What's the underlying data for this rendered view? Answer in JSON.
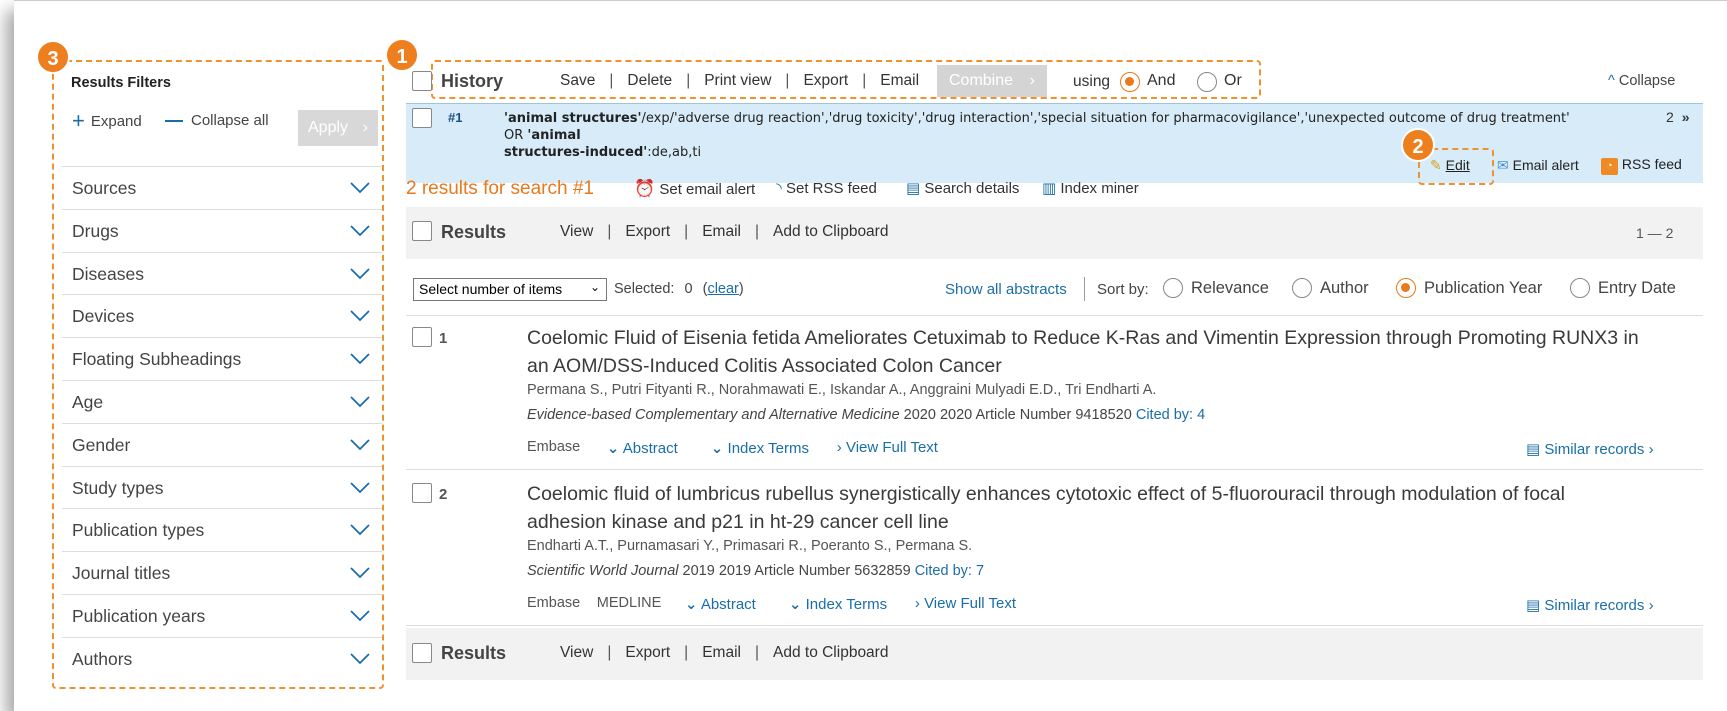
{
  "badges": [
    "1",
    "2",
    "3"
  ],
  "sidebar": {
    "title": "Results Filters",
    "expand": "Expand",
    "collapse_all": "Collapse all",
    "apply": "Apply",
    "facets": [
      "Sources",
      "Drugs",
      "Diseases",
      "Devices",
      "Floating Subheadings",
      "Age",
      "Gender",
      "Study types",
      "Publication types",
      "Journal titles",
      "Publication years",
      "Authors"
    ]
  },
  "history": {
    "label": "History",
    "actions": [
      "Save",
      "Delete",
      "Print view",
      "Export",
      "Email"
    ],
    "combine": "Combine",
    "using": "using",
    "and": "And",
    "or": "Or",
    "collapse": "Collapse",
    "row_id": "#1",
    "query_bold1": "'animal structures'",
    "query_text1": "/exp/'adverse drug reaction','drug toxicity','drug interaction','special situation for pharmacovigilance','unexpected outcome of drug treatment' OR ",
    "query_bold2": "'animal",
    "query_bold3": "structures-induced'",
    "query_text2": ":de,ab,ti",
    "count": "2",
    "edit": "Edit",
    "email_alert": "Email alert",
    "rss_feed": "RSS feed"
  },
  "results_header": {
    "summary": "2 results for search #1",
    "set_email_alert": "Set email alert",
    "set_rss_feed": "Set RSS feed",
    "search_details": "Search details",
    "index_miner": "Index miner"
  },
  "results_bar": {
    "label": "Results",
    "actions": [
      "View",
      "Export",
      "Email",
      "Add to Clipboard"
    ],
    "range": "1 — 2"
  },
  "sort": {
    "select_placeholder": "Select number of items",
    "selected_label": "Selected:",
    "selected_count": "0",
    "clear": "clear",
    "show_all_abstracts": "Show all abstracts",
    "sort_by": "Sort by:",
    "options": [
      "Relevance",
      "Author",
      "Publication Year",
      "Entry Date"
    ],
    "selected_option": "Publication Year"
  },
  "records": [
    {
      "num": "1",
      "title_line1": "Coelomic Fluid of Eisenia fetida Ameliorates Cetuximab to Reduce K-Ras and Vimentin Expression through Promoting RUNX3 in",
      "title_line2": "an AOM/DSS-Induced Colitis Associated Colon Cancer",
      "authors": "Permana S., Putri Fityanti R., Norahmawati E., Iskandar A., Anggraini Mulyadi E.D., Tri Endharti A.",
      "journal": "Evidence-based Complementary and Alternative Medicine",
      "details": "2020 2020 Article Number 9418520",
      "cited": "Cited by: 4",
      "sources": [
        "Embase"
      ],
      "abstract": "Abstract",
      "index_terms": "Index Terms",
      "full_text": "View Full Text",
      "similar": "Similar records"
    },
    {
      "num": "2",
      "title_line1": "Coelomic fluid of lumbricus rubellus synergistically enhances cytotoxic effect of 5-fluorouracil through modulation of focal",
      "title_line2": "adhesion kinase and p21 in ht-29 cancer cell line",
      "authors": "Endharti A.T., Purnamasari Y., Primasari R., Poeranto S., Permana S.",
      "journal": "Scientific World Journal",
      "details": "2019 2019 Article Number 5632859",
      "cited": "Cited by: 7",
      "sources": [
        "Embase",
        "MEDLINE"
      ],
      "abstract": "Abstract",
      "index_terms": "Index Terms",
      "full_text": "View Full Text",
      "similar": "Similar records"
    }
  ],
  "colors": {
    "accent_orange": "#e8791d",
    "link_blue": "#1a6ea8",
    "history_row_bg": "#d7ecf8"
  }
}
